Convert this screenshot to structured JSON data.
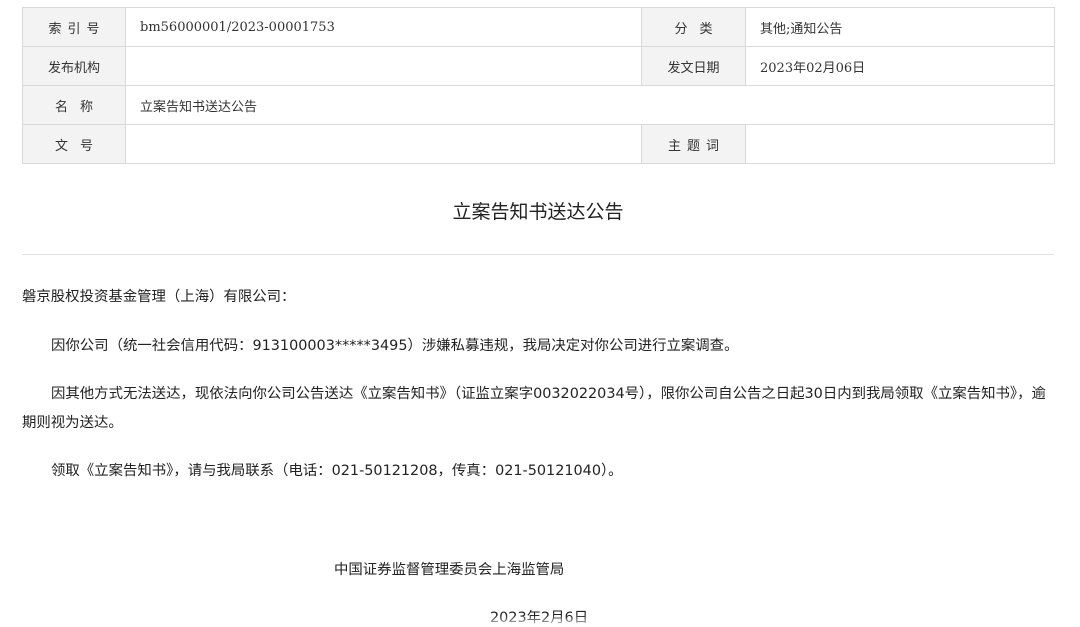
{
  "meta": {
    "index_label": "索引号",
    "index_value": "bm56000001/2023-00001753",
    "category_label": "分类",
    "category_value": "其他;通知公告",
    "publisher_label": "发布机构",
    "publisher_value": "",
    "date_label": "发文日期",
    "date_value": "2023年02月06日",
    "name_label": "名称",
    "name_value": "立案告知书送达公告",
    "doc_no_label": "文号",
    "doc_no_value": "",
    "keywords_label": "主题词",
    "keywords_value": ""
  },
  "document": {
    "title": "立案告知书送达公告",
    "addressee": "磐京股权投资基金管理（上海）有限公司：",
    "paragraphs": [
      "因你公司（统一社会信用代码：913100003*****3495）涉嫌私募违规，我局决定对你公司进行立案调查。",
      "因其他方式无法送达，现依法向你公司公告送达《立案告知书》（证监立案字0032022034号），限你公司自公告之日起30日内到我局领取《立案告知书》，逾期则视为送达。",
      "领取《立案告知书》，请与我局联系（电话：021-50121208，传真：021-50121040）。"
    ],
    "signature": "中国证券监督管理委员会上海监管局",
    "sign_date": "2023年2月6日"
  }
}
